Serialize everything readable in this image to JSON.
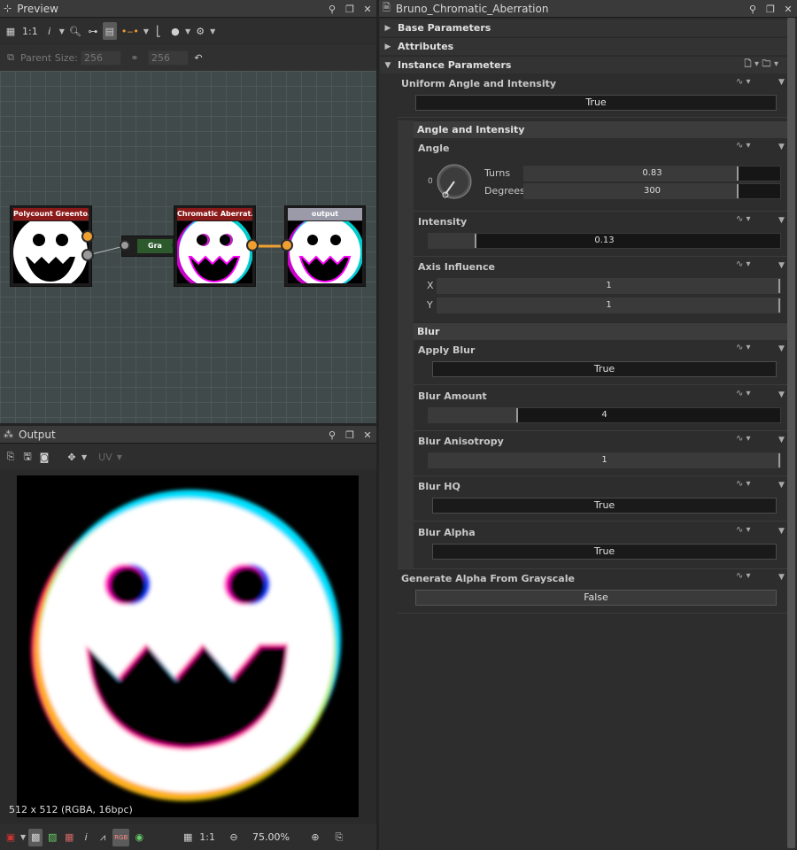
{
  "preview": {
    "title": "Preview",
    "toolbar": {
      "ratio": "1:1",
      "info": "i"
    },
    "parent_size_label": "Parent Size:",
    "parent_width": "256",
    "parent_height": "256"
  },
  "nodes": [
    {
      "title": "Polycount Greento...",
      "color": "#8b1a1a"
    },
    {
      "title": "Gra",
      "color": "#2d5a2d"
    },
    {
      "title": "Chromatic Aberrat...",
      "color": "#8b1a1a"
    },
    {
      "title": "output",
      "color": "#9a9aa8"
    }
  ],
  "output": {
    "title": "Output",
    "uv_label": "UV",
    "image_info": "512 x 512 (RGBA, 16bpc)",
    "ratio": "1:1",
    "zoom": "75.00%"
  },
  "inspector": {
    "title": "Bruno_Chromatic_Aberration",
    "sections": {
      "base": "Base Parameters",
      "attributes": "Attributes",
      "instance": "Instance Parameters",
      "angle_intensity": "Angle and Intensity",
      "blur": "Blur"
    },
    "params": {
      "uniform": {
        "label": "Uniform Angle and Intensity",
        "value": "True"
      },
      "angle": {
        "label": "Angle",
        "dial_zero": "0",
        "turns_label": "Turns",
        "turns_value": "0.83",
        "degrees_label": "Degrees",
        "degrees_value": "300"
      },
      "intensity": {
        "label": "Intensity",
        "value": "0.13"
      },
      "axis": {
        "label": "Axis Influence",
        "x_label": "X",
        "x_value": "1",
        "y_label": "Y",
        "y_value": "1"
      },
      "apply_blur": {
        "label": "Apply Blur",
        "value": "True"
      },
      "blur_amount": {
        "label": "Blur Amount",
        "value": "4"
      },
      "blur_aniso": {
        "label": "Blur Anisotropy",
        "value": "1"
      },
      "blur_hq": {
        "label": "Blur HQ",
        "value": "True"
      },
      "blur_alpha": {
        "label": "Blur Alpha",
        "value": "True"
      },
      "gen_alpha": {
        "label": "Generate Alpha From Grayscale",
        "value": "False"
      }
    }
  }
}
